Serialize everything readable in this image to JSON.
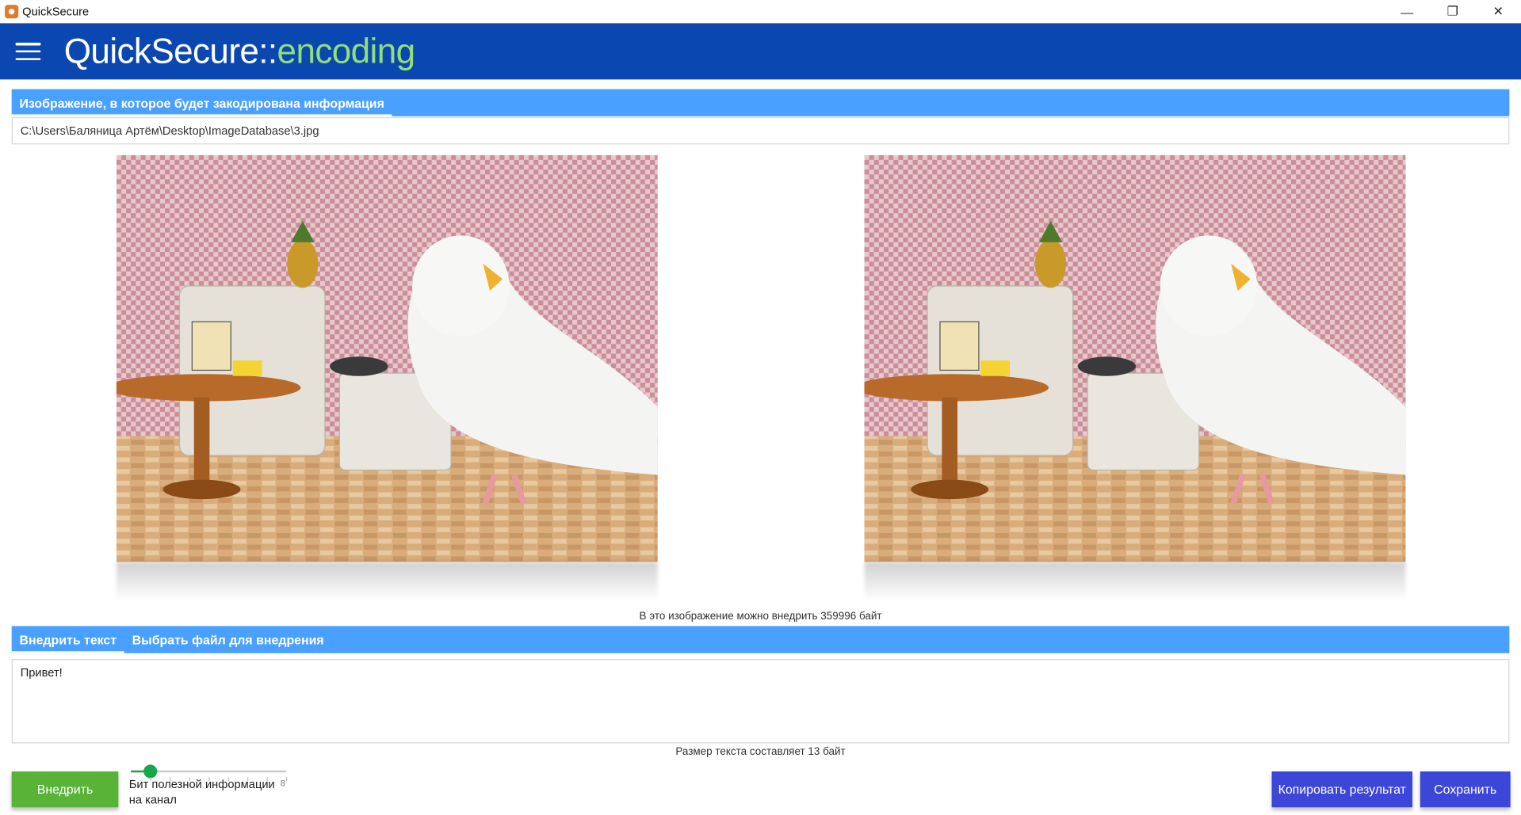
{
  "window": {
    "title": "QuickSecure",
    "minimize_glyph": "—",
    "maximize_glyph": "❐",
    "close_glyph": "✕"
  },
  "header": {
    "brand": "QuickSecure",
    "separator": "::",
    "module": "encoding",
    "brand_color": "#0b47b0",
    "module_color": "#8fe07a"
  },
  "image_section": {
    "tab_label": "Изображение, в которое будет закодирована информация",
    "path_value": "C:\\Users\\Баляница Артём\\Desktop\\ImageDatabase\\3.jpg",
    "capacity_text": "В это изображение можно внедрить 359996 байт"
  },
  "embed_section": {
    "tabs": [
      {
        "label": "Внедрить текст",
        "active": true
      },
      {
        "label": "Выбрать файл для внедрения",
        "active": false
      }
    ],
    "text_value": "Привет!",
    "size_text": "Размер текста составляет 13 байт"
  },
  "controls": {
    "embed_button": "Внедрить",
    "slider_label": "Бит полезной информации на канал",
    "slider_value": 1,
    "slider_min": 1,
    "slider_max": 8,
    "slider_max_label": "8",
    "copy_button": "Копировать результат",
    "save_button": "Сохранить",
    "accent_green": "#58b336",
    "accent_blue": "#3c46d8",
    "section_blue": "#4aa0ff"
  }
}
